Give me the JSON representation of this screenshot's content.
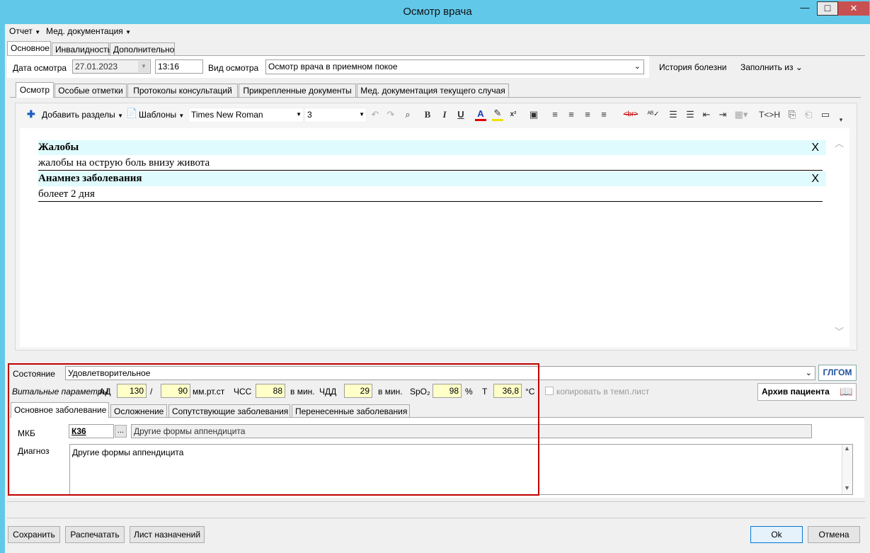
{
  "window": {
    "title": "Осмотр врача",
    "min": "—",
    "max": "□",
    "close": "✕"
  },
  "menu": {
    "report": "Отчет",
    "meddoc": "Мед. документация"
  },
  "top_tabs": [
    "Основное",
    "Инвалидность",
    "Дополнительно"
  ],
  "exam": {
    "date_label": "Дата осмотра",
    "date_value": "27.01.2023",
    "time_value": "13:16",
    "type_label": "Вид осмотра",
    "type_value": "Осмотр врача в приемном покое",
    "history_button": "История болезни",
    "fill_from_button": "Заполнить из"
  },
  "inner_tabs": [
    "Осмотр",
    "Особые отметки",
    "Протоколы консультаций",
    "Прикрепленные документы",
    "Мед. документация текущего случая"
  ],
  "toolbar": {
    "add_sections": "Добавить разделы",
    "templates": "Шаблоны",
    "font": "Times New Roman",
    "size": "3",
    "bold": "B",
    "italic": "I",
    "underline": "U",
    "text_color": "A",
    "superscript": "x²",
    "strike_label": "<br>",
    "tc_h": "T<>H"
  },
  "editor": {
    "sections": [
      {
        "title": "Жалобы",
        "text": "жалобы на острую боль внизу живота",
        "remove": "X"
      },
      {
        "title": "Анамнез заболевания",
        "text": "болеет 2 дня",
        "remove": "X"
      }
    ]
  },
  "state": {
    "label": "Состояние",
    "value": "Удовлетворительное",
    "logo": "ГЛГОМ"
  },
  "vitals": {
    "label": "Витальные параметры",
    "ad_label": "АД",
    "ad_sys": "130",
    "slash": "/",
    "ad_dia": "90",
    "ad_unit": "мм.рт.ст",
    "hr_label": "ЧСС",
    "hr_value": "88",
    "hr_unit": "в мин.",
    "rr_label": "ЧДД",
    "rr_value": "29",
    "rr_unit": "в мин.",
    "spo2_label": "SpO₂",
    "spo2_value": "98",
    "spo2_unit": "%",
    "t_label": "T",
    "t_value": "36,8",
    "t_unit": "°C",
    "copy_label": "копировать в темп.лист",
    "archive_button": "Архив пациента"
  },
  "diag_tabs": [
    "Основное заболевание",
    "Осложнение",
    "Сопутствующие заболевания",
    "Перенесенные заболевания"
  ],
  "diagnosis": {
    "mkb_label": "МКБ",
    "mkb_code": "К36",
    "mkb_browse": "...",
    "mkb_name": "Другие формы аппендицита",
    "diag_label": "Диагноз",
    "diag_text": "Другие формы аппендицита"
  },
  "footer": {
    "save": "Сохранить",
    "print": "Распечатать",
    "prescriptions": "Лист назначений",
    "ok": "Ok",
    "cancel": "Отмена"
  },
  "colors": {
    "title_bar": "#62c8ea",
    "section_bg": "#e0fbfd",
    "vital_bg": "#ffffc8",
    "highlight_frame": "#c00000"
  }
}
